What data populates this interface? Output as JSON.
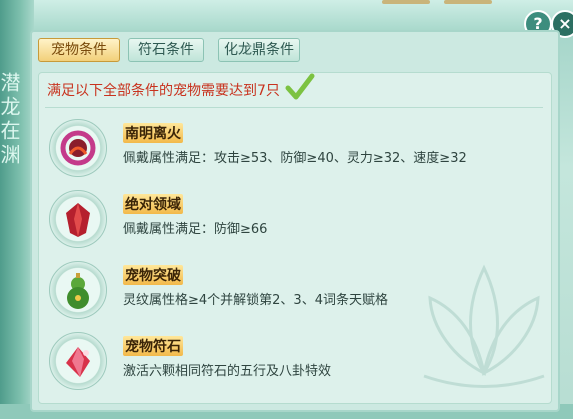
{
  "tabs": [
    {
      "label": "宠物条件",
      "active": true
    },
    {
      "label": "符石条件",
      "active": false
    },
    {
      "label": "化龙鼎条件",
      "active": false
    }
  ],
  "summary": "满足以下全部条件的宠物需要达到7只",
  "conditions": [
    {
      "name": "南明离火",
      "desc": "佩戴属性满足：攻击≥53、防御≥40、灵力≥32、速度≥32",
      "icon": "fire-ring-icon"
    },
    {
      "name": "绝对领域",
      "desc": "佩戴属性满足：防御≥66",
      "icon": "red-crystal-icon"
    },
    {
      "name": "宠物突破",
      "desc": "灵纹属性格≥4个并解锁第2、3、4词条天赋格",
      "icon": "gourd-icon"
    },
    {
      "name": "宠物符石",
      "desc": "激活六颗相同符石的五行及八卦特效",
      "icon": "rune-stone-icon"
    }
  ],
  "buttons": {
    "help": "?",
    "close": "×"
  },
  "side_text": "潜龙在渊",
  "colors": {
    "accent": "#f2b94a",
    "summary_text": "#c8321e",
    "check": "#7cc241"
  }
}
